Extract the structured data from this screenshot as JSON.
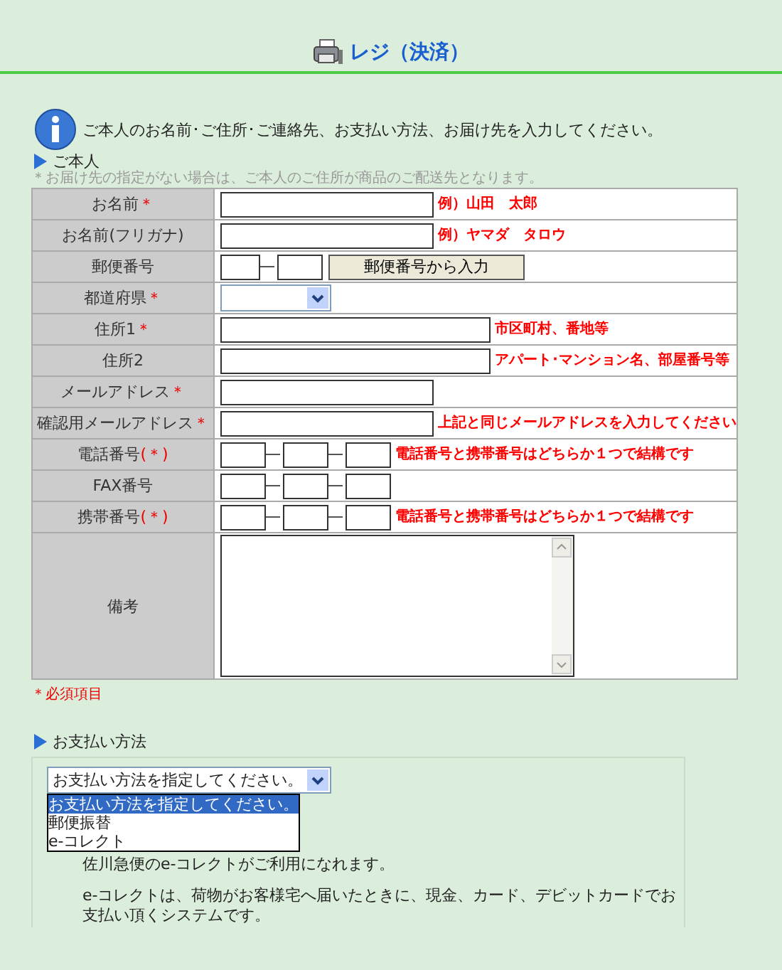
{
  "header": {
    "title": "レジ（決済）"
  },
  "intro": "ご本人のお名前･ご住所･ご連絡先、お支払い方法、お届け先を入力してください。",
  "customer": {
    "heading": "ご本人",
    "note": "＊お届け先の指定がない場合は、ご本人のご住所が商品のご配送先となります。",
    "rows": [
      {
        "kind": "text",
        "label": "お名前",
        "mark": "＊",
        "hint": "例）山田　太郎"
      },
      {
        "kind": "text",
        "label": "お名前(フリガナ)",
        "hint": "例）ヤマダ　タロウ"
      },
      {
        "kind": "postal",
        "label": "郵便番号",
        "button": "郵便番号から入力"
      },
      {
        "kind": "select",
        "label": "都道府県",
        "mark": "＊"
      },
      {
        "kind": "wide_text",
        "label": "住所1",
        "mark": "＊",
        "hint": "市区町村、番地等"
      },
      {
        "kind": "wide_text",
        "label": "住所2",
        "hint": "アパート･マンション名、部屋番号等"
      },
      {
        "kind": "text",
        "label": "メールアドレス",
        "mark": "＊"
      },
      {
        "kind": "text",
        "label": "確認用メールアドレス",
        "mark": "＊",
        "hint": "上記と同じメールアドレスを入力してください"
      },
      {
        "kind": "phone",
        "label": "電話番号",
        "mark": "(＊)",
        "hint": "電話番号と携帯番号はどちらか１つで結構です"
      },
      {
        "kind": "phone",
        "label": "FAX番号"
      },
      {
        "kind": "phone",
        "label": "携帯番号",
        "mark": "(＊)",
        "hint": "電話番号と携帯番号はどちらか１つで結構です"
      },
      {
        "kind": "textarea",
        "label": "備考"
      }
    ],
    "required_note": "＊必須項目"
  },
  "payment": {
    "heading": "お支払い方法",
    "select_value": "お支払い方法を指定してください。",
    "options": [
      {
        "label": "お支払い方法を指定してください。",
        "selected": true
      },
      {
        "label": "郵便振替",
        "selected": false
      },
      {
        "label": "e-コレクト",
        "selected": false
      }
    ],
    "paragraphs": [
      "佐川急便のe-コレクトがご利用になれます。",
      "e-コレクトは、荷物がお客様宅へ届いたときに、現金、カード、デビットカードでお支払い頂くシステムです。"
    ]
  }
}
